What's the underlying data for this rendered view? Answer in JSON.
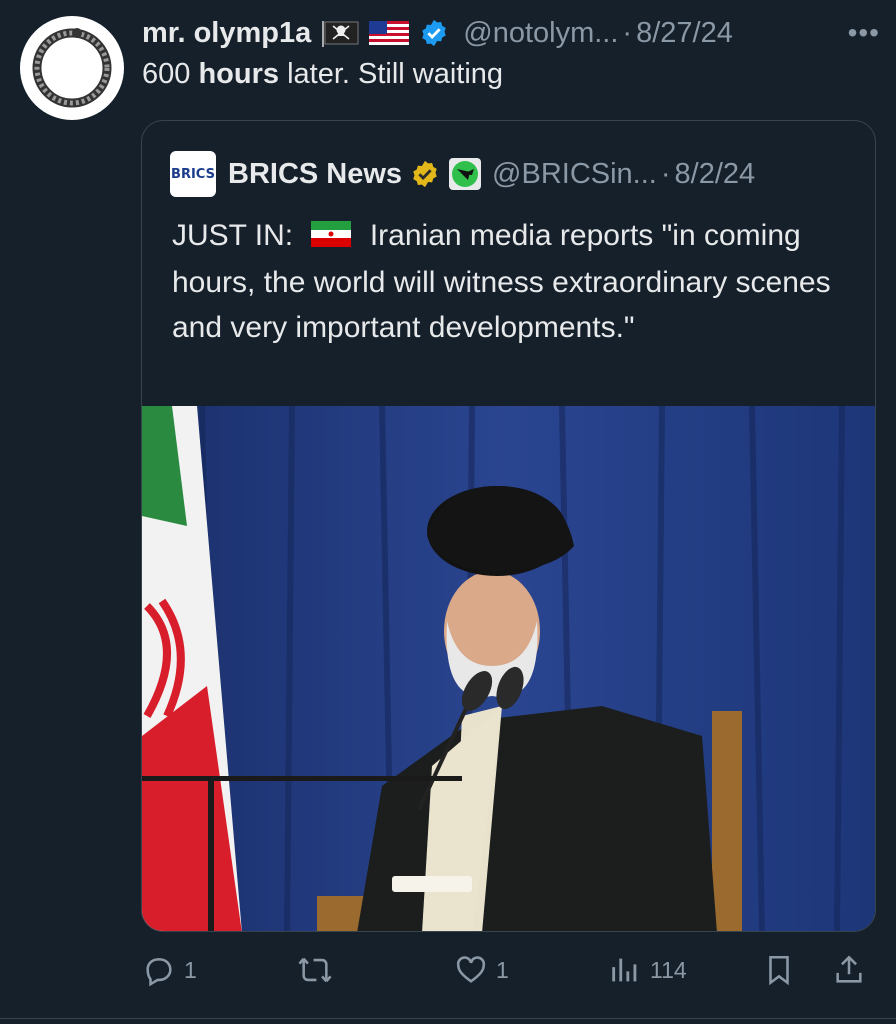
{
  "tweet": {
    "display_name": "mr. olymp1a",
    "handle": "@notolym...",
    "separator": "·",
    "date": "8/27/24",
    "more": "•••",
    "text_count": "600",
    "text_bold": "hours",
    "text_rest": "later. Still waiting"
  },
  "quote": {
    "logo_text": "BRICS",
    "display_name": "BRICS News",
    "handle": "@BRICSin...",
    "separator": "·",
    "date": "8/2/24",
    "text_prefix": "JUST IN:",
    "text_body": "Iranian media reports \"in coming hours, the world will witness extraordinary scenes and very important developments.\""
  },
  "actions": {
    "replies": "1",
    "reposts": "",
    "likes": "1",
    "views": "114"
  },
  "colors": {
    "background": "#15202b",
    "text": "#e7e9ea",
    "muted": "#8b98a5",
    "border": "#38444d",
    "verified_blue": "#1d9bf0",
    "verified_gold": "#e2b719"
  },
  "icons": {
    "reply": "reply-icon",
    "repost": "repost-icon",
    "like": "like-icon",
    "views": "views-icon",
    "bookmark": "bookmark-icon",
    "share": "share-icon"
  }
}
